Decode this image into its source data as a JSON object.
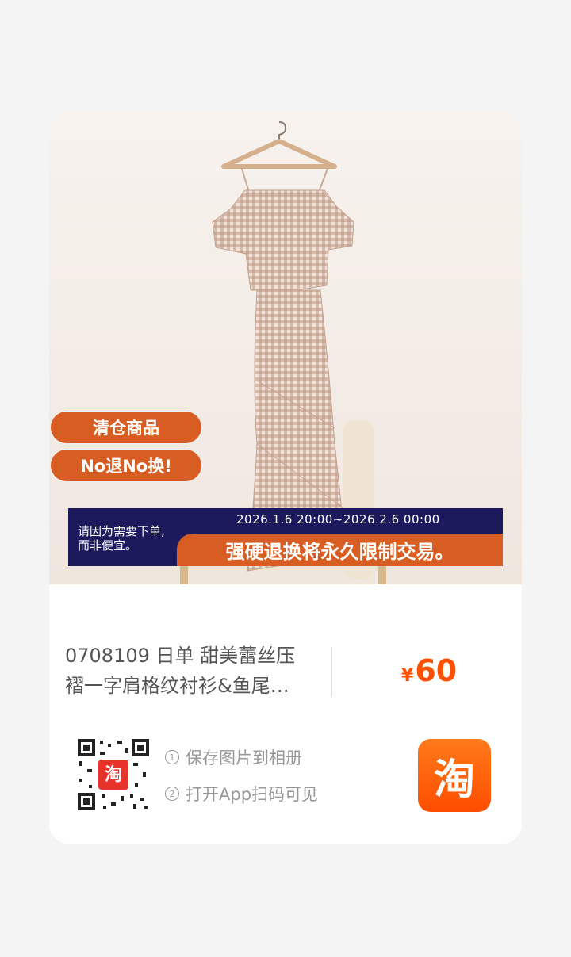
{
  "badges": {
    "clearance": "清仓商品",
    "no_return": "No退No换!"
  },
  "notice": {
    "left_line1": "请因为需要下单,",
    "left_line2": "而非便宜。",
    "date_range": "2026.1.6 20:00~2026.2.6 00:00",
    "warning": "强硬退换将永久限制交易。"
  },
  "product": {
    "title_line1": "0708109 日单 甜美蕾丝压",
    "title_line2": "褶一字肩格纹衬衫&鱼尾…",
    "currency": "¥",
    "price": "60"
  },
  "share": {
    "qr_logo_text": "淘",
    "step1_num": "1",
    "step1": "保存图片到相册",
    "step2_num": "2",
    "step2": "打开App扫码可见",
    "app_logo_text": "淘"
  },
  "colors": {
    "accent": "#d75d22",
    "price": "#ff5000",
    "notice_bg": "#1c1a5c"
  }
}
